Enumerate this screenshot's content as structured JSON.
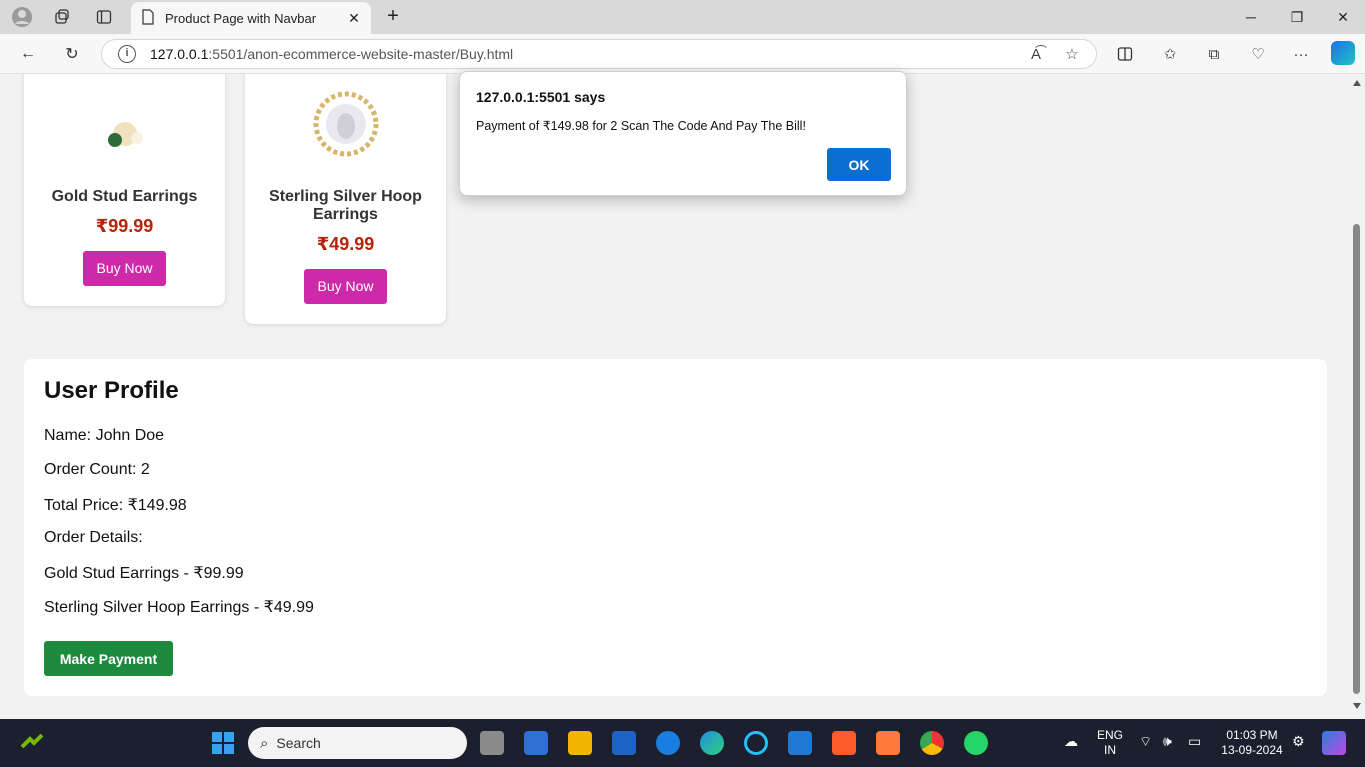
{
  "browser": {
    "tab_title": "Product Page with Navbar",
    "url_host": "127.0.0.1",
    "url_rest": ":5501/anon-ecommerce-website-master/Buy.html"
  },
  "products": [
    {
      "name": "Gold Stud Earrings",
      "price": "₹99.99",
      "button": "Buy Now"
    },
    {
      "name": "Sterling Silver Hoop Earrings",
      "price": "₹49.99",
      "button": "Buy Now"
    }
  ],
  "profile": {
    "title": "User Profile",
    "name": "Name: John Doe",
    "order_count": "Order Count: 2",
    "total_price": "Total Price: ₹149.98",
    "order_details_label": "Order Details:",
    "orders": [
      "Gold Stud Earrings - ₹99.99",
      "Sterling Silver Hoop Earrings - ₹49.99"
    ],
    "pay_button": "Make Payment"
  },
  "dialog": {
    "title": "127.0.0.1:5501 says",
    "message": "Payment of ₹149.98 for 2 Scan The Code And Pay The Bill!",
    "ok": "OK"
  },
  "taskbar": {
    "search_placeholder": "Search",
    "lang_top": "ENG",
    "lang_bottom": "IN",
    "time": "01:03 PM",
    "date": "13-09-2024"
  }
}
